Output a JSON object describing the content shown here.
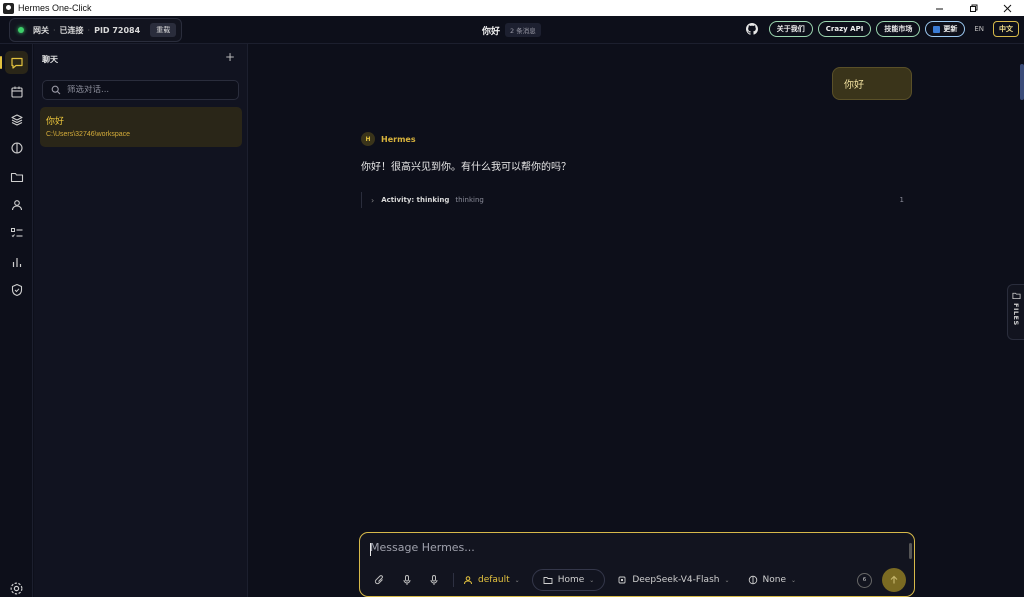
{
  "window": {
    "title": "Hermes One-Click"
  },
  "header": {
    "gateway_label": "网关",
    "gateway_status": "已连接",
    "gateway_pid": "PID 72084",
    "reload_label": "重载",
    "chat_title": "你好",
    "message_count": "2 条消息",
    "links": [
      "关于我们",
      "Crazy API",
      "技能市场"
    ],
    "update_label": "更新",
    "lang_en": "EN",
    "lang_zh": "中文"
  },
  "sidebar": {
    "heading": "聊天",
    "search_placeholder": "筛选对话...",
    "conversations": [
      {
        "title": "你好",
        "path": "C:\\Users\\32746\\workspace"
      }
    ]
  },
  "chat": {
    "user_message": "你好",
    "agent_initial": "H",
    "agent_name": "Hermes",
    "agent_reply": "你好！很高兴见到你。有什么我可以帮你的吗？",
    "activity_label": "Activity: thinking",
    "activity_value": "thinking",
    "activity_count": "1",
    "files_tab": "FILES"
  },
  "composer": {
    "placeholder": "Message Hermes...",
    "profile": "default",
    "workspace": "Home",
    "model": "DeepSeek-V4-Flash",
    "reasoning": "None",
    "context_value": "6"
  },
  "colors": {
    "accent": "#e3c23f",
    "success": "#3ecf6b",
    "background": "#0d0f1a"
  }
}
